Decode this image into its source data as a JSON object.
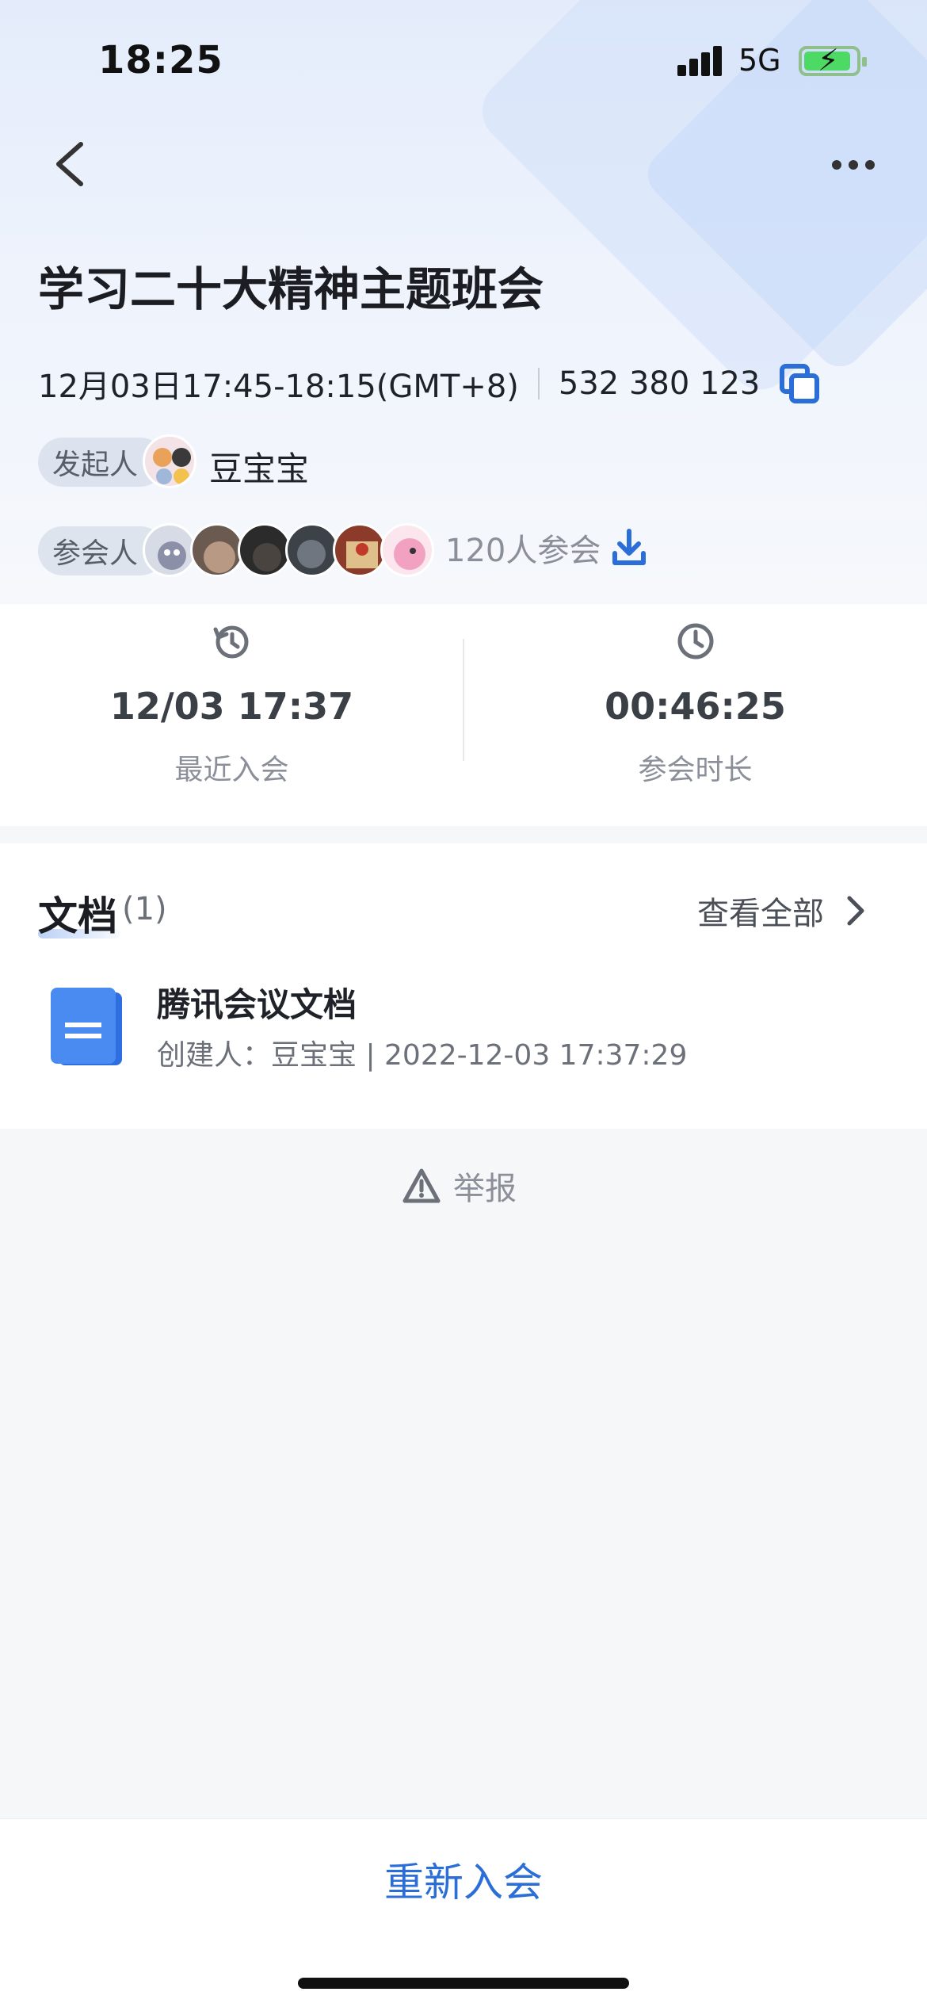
{
  "status_bar": {
    "time": "18:25",
    "network": "5G"
  },
  "meeting": {
    "title": "学习二十大精神主题班会",
    "time_range": "12月03日17:45-18:15(GMT+8)",
    "meeting_id": "532 380 123"
  },
  "initiator": {
    "label": "发起人",
    "name": "豆宝宝"
  },
  "participants": {
    "label": "参会人",
    "count_text": "120人参会"
  },
  "stats": {
    "last_join": {
      "value": "12/03 17:37",
      "label": "最近入会"
    },
    "duration": {
      "value": "00:46:25",
      "label": "参会时长"
    }
  },
  "documents": {
    "title": "文档",
    "count": "(1)",
    "view_all": "查看全部",
    "items": [
      {
        "name": "腾讯会议文档",
        "meta": "创建人：豆宝宝 | 2022-12-03 17:37:29"
      }
    ]
  },
  "report_label": "举报",
  "rejoin_label": "重新入会",
  "colors": {
    "accent": "#2b6ed8",
    "doc_icon": "#3b7ef0"
  }
}
